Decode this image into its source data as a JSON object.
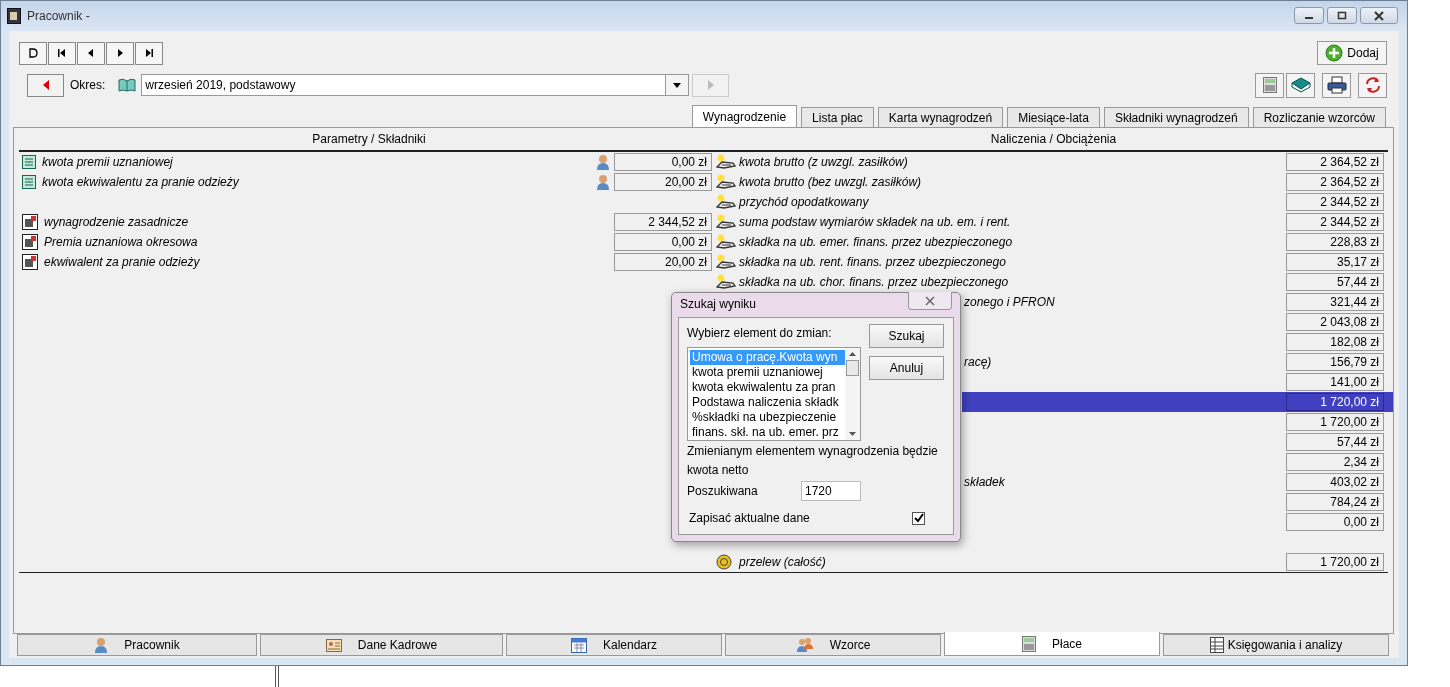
{
  "window": {
    "title": "Pracownik -"
  },
  "period": {
    "label": "Okres:",
    "value": "wrzesień 2019, podstawowy"
  },
  "add_button": "Dodaj",
  "tabs": [
    {
      "label": "Wynagrodzenie",
      "selected": true
    },
    {
      "label": "Lista płac",
      "selected": false
    },
    {
      "label": "Karta wynagrodzeń",
      "selected": false
    },
    {
      "label": "Miesiące-lata",
      "selected": false
    },
    {
      "label": "Składniki wynagrodzeń",
      "selected": false
    },
    {
      "label": "Rozliczanie wzorców",
      "selected": false
    }
  ],
  "columns": [
    "Parametry / Składniki",
    "Naliczenia / Obciążenia"
  ],
  "parameters": [
    {
      "kind": "parameter",
      "name": "kwota premii uznaniowej",
      "value": "0,00 zł"
    },
    {
      "kind": "parameter",
      "name": "kwota ekwiwalentu za pranie odzieży",
      "value": "20,00 zł"
    },
    {
      "kind": "gap"
    },
    {
      "kind": "component",
      "name": "wynagrodzenie zasadnicze",
      "value": "2 344,52 zł"
    },
    {
      "kind": "component",
      "name": "Premia uznaniowa okresowa",
      "value": "0,00 zł"
    },
    {
      "kind": "component",
      "name": "ekwiwalent za pranie odzieży",
      "value": "20,00 zł"
    }
  ],
  "charges": [
    {
      "kind": "charge",
      "label": "kwota brutto (z uwzgl. zasiłków)",
      "value": "2 364,52 zł",
      "selected": false
    },
    {
      "kind": "charge",
      "label": "kwota brutto (bez uwzgl. zasiłków)",
      "value": "2 364,52 zł",
      "selected": false
    },
    {
      "kind": "charge",
      "label": "przychód opodatkowany",
      "value": "2 344,52 zł",
      "selected": false
    },
    {
      "kind": "charge",
      "label": "suma podstaw wymiarów składek na ub. em. i rent.",
      "value": "2 344,52 zł",
      "selected": false
    },
    {
      "kind": "charge",
      "label": "składka na ub. emer. finans. przez ubezpieczonego",
      "value": "228,83 zł",
      "selected": false
    },
    {
      "kind": "charge",
      "label": "składka na ub. rent. finans. przez ubezpieczonego",
      "value": "35,17 zł",
      "selected": false
    },
    {
      "kind": "charge",
      "label": "składka na ub. chor. finans. przez ubezpieczonego",
      "value": "57,44 zł",
      "selected": false
    },
    {
      "kind": "covered",
      "label": "zonego i PFRON",
      "value": "321,44 zł",
      "selected": false
    },
    {
      "kind": "covered",
      "value": "2 043,08 zł",
      "selected": false
    },
    {
      "kind": "covered",
      "value": "182,08 zł",
      "selected": false
    },
    {
      "kind": "covered",
      "label": "racę)",
      "value": "156,79 zł",
      "selected": false
    },
    {
      "kind": "covered",
      "value": "141,00 zł",
      "selected": false
    },
    {
      "kind": "covered",
      "value": "1 720,00 zł",
      "selected": true
    },
    {
      "kind": "covered",
      "value": "1 720,00 zł",
      "selected": false
    },
    {
      "kind": "covered",
      "value": "57,44 zł",
      "selected": false
    },
    {
      "kind": "covered",
      "value": "2,34 zł",
      "selected": false
    },
    {
      "kind": "covered",
      "label": "składek",
      "value": "403,02 zł",
      "selected": false
    },
    {
      "kind": "covered",
      "value": "784,24 zł",
      "selected": false
    },
    {
      "kind": "covered",
      "value": "0,00 zł",
      "selected": false
    },
    {
      "kind": "gap"
    },
    {
      "kind": "payment",
      "label": "przelew (całość)",
      "value": "1 720,00 zł",
      "selected": false
    }
  ],
  "dialog": {
    "title": "Szukaj wyniku",
    "list_label": "Wybierz element do zmian:",
    "items": [
      {
        "label": "Umowa o pracę.Kwota wyn",
        "selected": true
      },
      {
        "label": "kwota premii uznaniowej",
        "selected": false
      },
      {
        "label": "kwota ekwiwalentu za pran",
        "selected": false
      },
      {
        "label": "Podstawa naliczenia składk",
        "selected": false
      },
      {
        "label": "%składki na ubezpieczenie",
        "selected": false
      },
      {
        "label": "finans. skł. na ub. emer. prz",
        "selected": false
      }
    ],
    "buttons": [
      "Szukaj",
      "Anuluj"
    ],
    "note": "Zmienianym elementem wynagrodzenia będzie",
    "target": "kwota netto",
    "search_label": "Poszukiwana",
    "search_value": "1720",
    "save": {
      "label": "Zapisać aktualne dane",
      "checked": true
    }
  },
  "bottom_tabs": [
    {
      "label": "Pracownik",
      "selected": false
    },
    {
      "label": "Dane Kadrowe",
      "selected": false
    },
    {
      "label": "Kalendarz",
      "selected": false
    },
    {
      "label": "Wzorce",
      "selected": false
    },
    {
      "label": "Płace",
      "selected": true
    },
    {
      "label": "Księgowania i analizy",
      "selected": false
    }
  ]
}
